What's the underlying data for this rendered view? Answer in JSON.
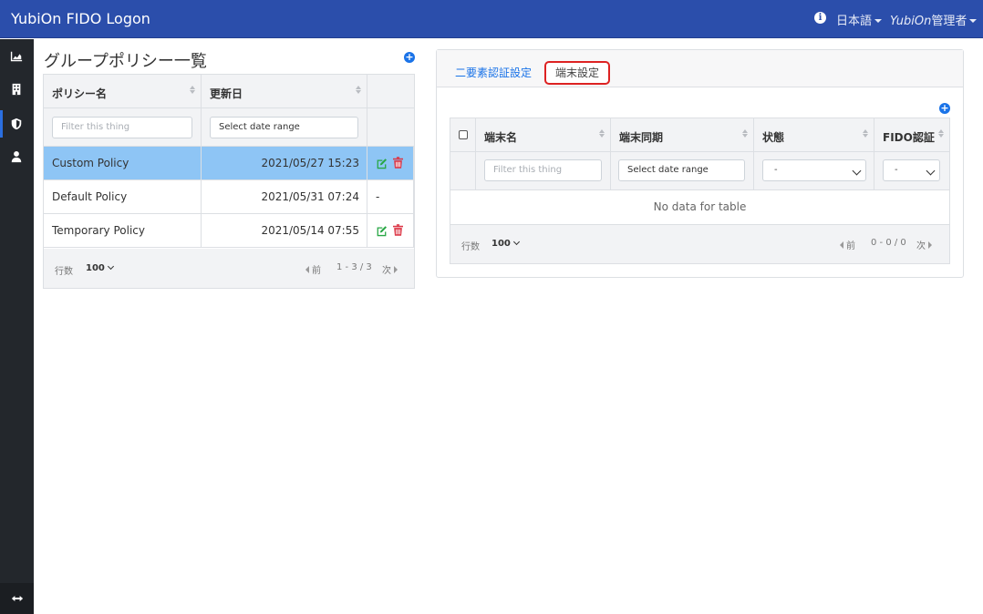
{
  "navbar": {
    "brand": "YubiOn FIDO Logon",
    "language": "日本語",
    "user_name_prefix": "YubiOn",
    "user_name_suffix": "管理者",
    "info_icon": "info-circle-icon"
  },
  "sidebar": {
    "items": [
      {
        "icon": "chart-area-icon",
        "label": "dashboard"
      },
      {
        "icon": "building-icon",
        "label": "organization"
      },
      {
        "icon": "shield-icon",
        "label": "policy",
        "active": true
      },
      {
        "icon": "user-icon",
        "label": "users"
      }
    ],
    "toggle_icon": "arrows-horizontal-icon"
  },
  "policy_list": {
    "title": "グループポリシー一覧",
    "columns": [
      "ポリシー名",
      "更新日"
    ],
    "filter_placeholder": "Filter this thing",
    "date_placeholder": "Select date range",
    "rows": [
      {
        "name": "Custom Policy",
        "updated": "2021/05/27 15:23",
        "actions": "edit-delete",
        "selected": true
      },
      {
        "name": "Default Policy",
        "updated": "2021/05/31 07:24",
        "actions": "-",
        "selected": false
      },
      {
        "name": "Temporary Policy",
        "updated": "2021/05/14 07:55",
        "actions": "edit-delete",
        "selected": false
      }
    ],
    "footer": {
      "rows_label": "行数",
      "per_page": "100",
      "prev": "前",
      "range": "1 - 3 / 3",
      "next": "次"
    }
  },
  "detail": {
    "tabs": [
      "二要素認証設定",
      "端末設定"
    ],
    "active_tab": "端末設定",
    "columns": [
      "端末名",
      "端末同期",
      "状態",
      "FIDO認証"
    ],
    "filter_placeholder": "Filter this thing",
    "date_placeholder": "Select date range",
    "state_select": "-",
    "fido_select": "-",
    "empty_message": "No data for table",
    "footer": {
      "rows_label": "行数",
      "per_page": "100",
      "prev": "前",
      "range": "0 - 0 / 0",
      "next": "次"
    }
  },
  "colors": {
    "navbar": "#2b4eab",
    "sidebar": "#23272c",
    "selected_row": "#8ec5f5",
    "accent": "#1a73e8",
    "edit": "#28a745",
    "delete": "#dc3545"
  }
}
